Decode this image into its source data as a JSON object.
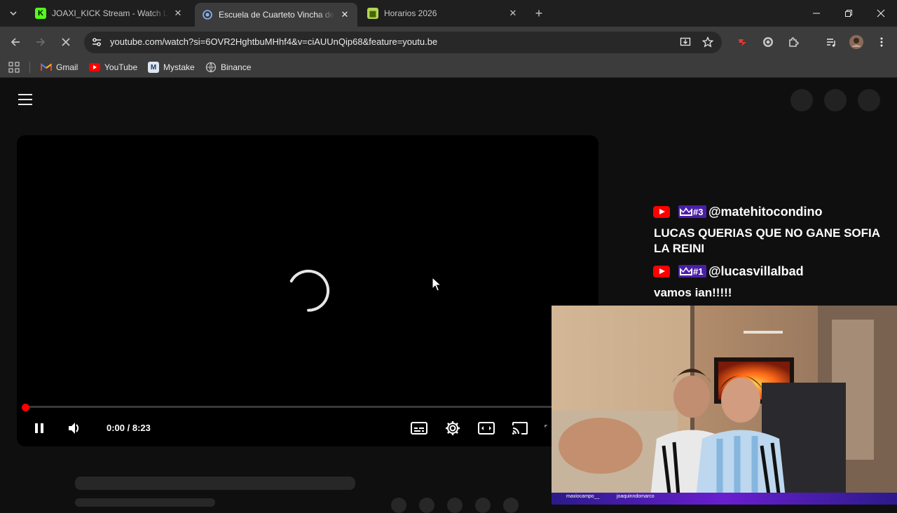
{
  "browser": {
    "tabs": [
      {
        "title": "JOAXI_KICK Stream - Watch Live on Kick",
        "favicon": "kick-icon",
        "favicon_color": "#53fc18",
        "active": false
      },
      {
        "title": "Escuela de Cuarteto Vincha de Oro",
        "favicon": "loading-globe-icon",
        "favicon_color": "#8ab4f8",
        "active": true
      },
      {
        "title": "Horarios 2026",
        "favicon": "sheets-icon",
        "favicon_color": "#b4d455",
        "active": false
      }
    ],
    "url": "youtube.com/watch?si=6OVR2HghtbuMHhf4&v=ciAUUnQip68&feature=youtu.be",
    "bookmarks": [
      {
        "label": "Gmail",
        "icon": "gmail-icon"
      },
      {
        "label": "YouTube",
        "icon": "youtube-icon"
      },
      {
        "label": "Mystake",
        "icon": "mystake-icon"
      },
      {
        "label": "Binance",
        "icon": "binance-icon"
      }
    ]
  },
  "player": {
    "time": "0:00 / 8:23",
    "progress": 0.0,
    "accent": "#ff0000"
  },
  "chat": [
    {
      "rank": "#3",
      "username": "@matehitocondino",
      "message": "LUCAS QUERIAS QUE NO GANE SOFIA LA REINI"
    },
    {
      "rank": "#1",
      "username": "@lucasvillalbad",
      "message": "vamos ian!!!!!"
    }
  ],
  "webcam": {
    "names": [
      "maxiocampo__",
      "joaquinndomarco"
    ]
  }
}
